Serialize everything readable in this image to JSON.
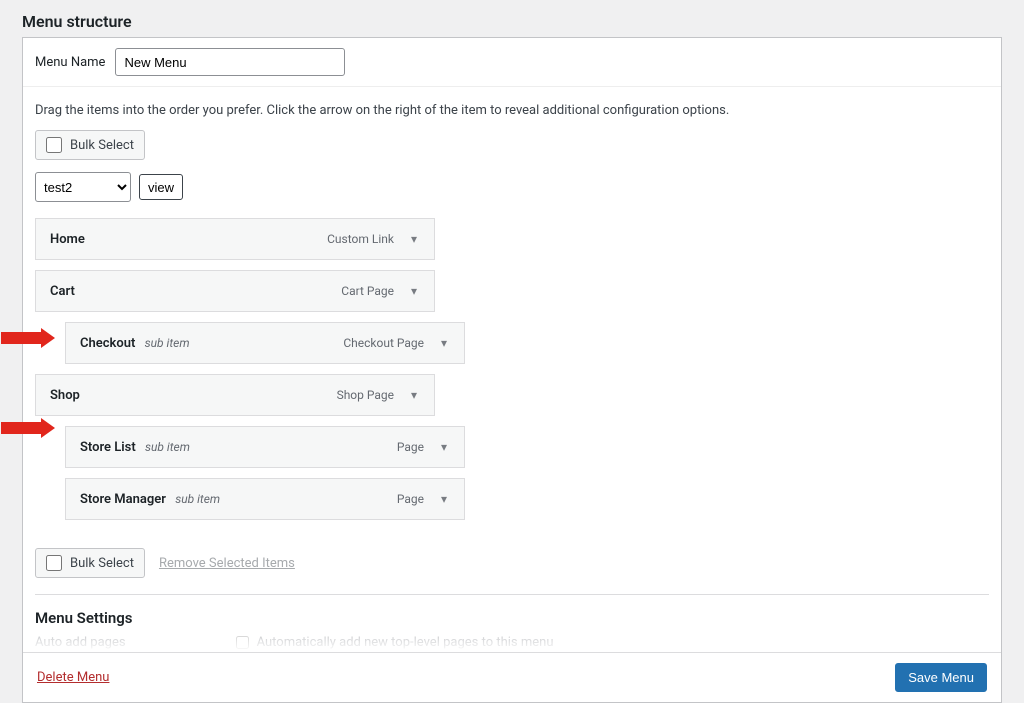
{
  "title": "Menu structure",
  "menuNameLabel": "Menu Name",
  "menuNameValue": "New Menu",
  "instructions": "Drag the items into the order you prefer. Click the arrow on the right of the item to reveal additional configuration options.",
  "bulkSelectLabel": "Bulk Select",
  "selectValue": "test2",
  "viewBtn": "view",
  "removeSelectedLabel": "Remove Selected Items",
  "items": [
    {
      "title": "Home",
      "sub": "",
      "type": "Custom Link",
      "depth": 0
    },
    {
      "title": "Cart",
      "sub": "",
      "type": "Cart Page",
      "depth": 0
    },
    {
      "title": "Checkout",
      "sub": "sub item",
      "type": "Checkout Page",
      "depth": 1
    },
    {
      "title": "Shop",
      "sub": "",
      "type": "Shop Page",
      "depth": 0
    },
    {
      "title": "Store List",
      "sub": "sub item",
      "type": "Page",
      "depth": 1
    },
    {
      "title": "Store Manager",
      "sub": "sub item",
      "type": "Page",
      "depth": 1
    }
  ],
  "settingsTitle": "Menu Settings",
  "autoAddLabel": "Auto add pages",
  "autoAddDesc": "Automatically add new top-level pages to this menu",
  "deleteMenuLabel": "Delete Menu",
  "saveMenuLabel": "Save Menu"
}
